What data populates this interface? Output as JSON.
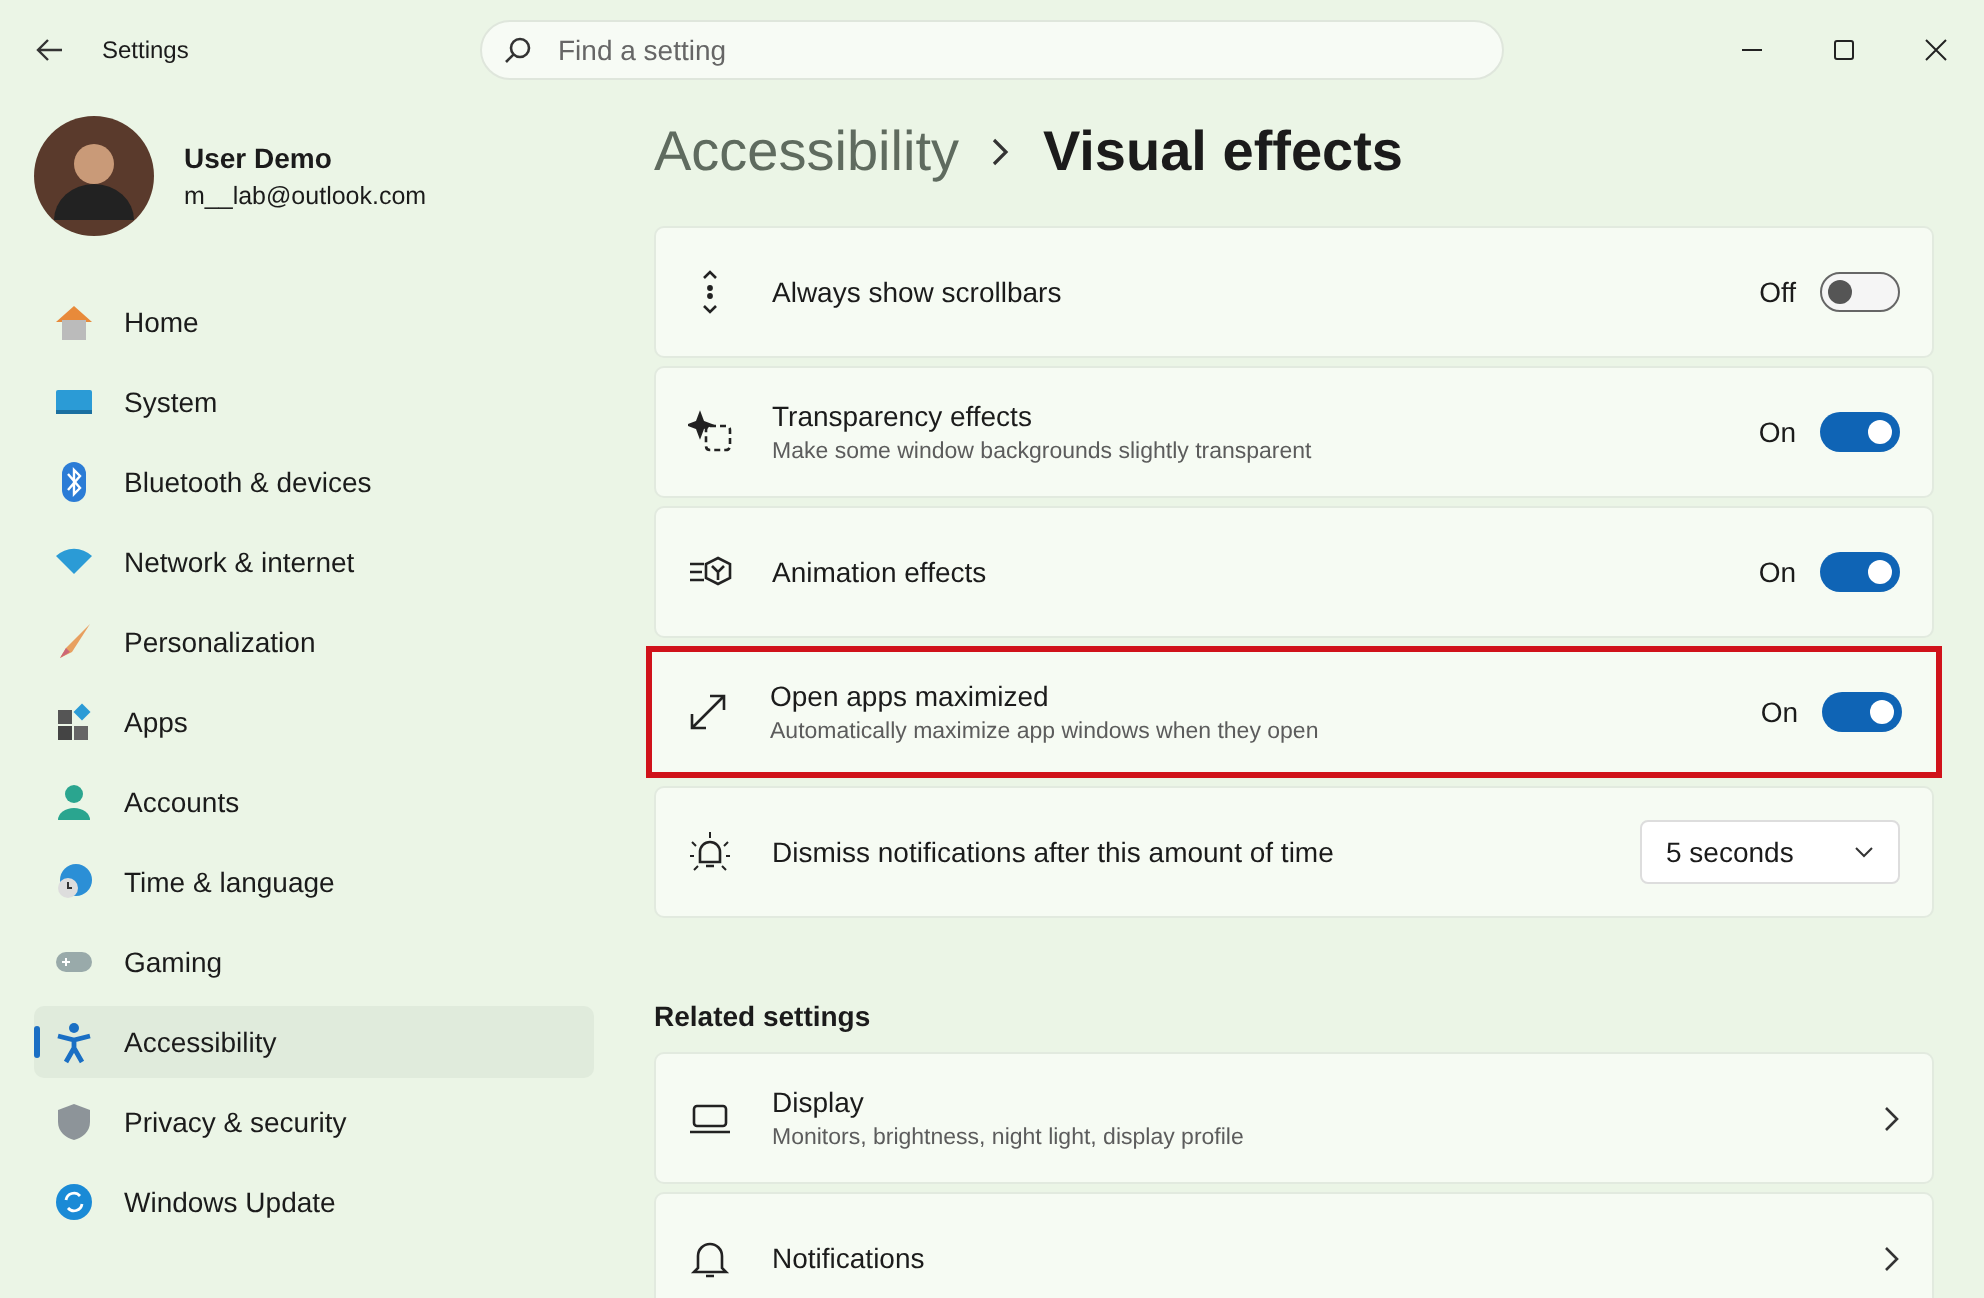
{
  "window": {
    "title": "Settings"
  },
  "search": {
    "placeholder": "Find a setting"
  },
  "profile": {
    "name": "User Demo",
    "email": "m__lab@outlook.com"
  },
  "sidebar": {
    "items": [
      {
        "label": "Home",
        "selected": false
      },
      {
        "label": "System",
        "selected": false
      },
      {
        "label": "Bluetooth & devices",
        "selected": false
      },
      {
        "label": "Network & internet",
        "selected": false
      },
      {
        "label": "Personalization",
        "selected": false
      },
      {
        "label": "Apps",
        "selected": false
      },
      {
        "label": "Accounts",
        "selected": false
      },
      {
        "label": "Time & language",
        "selected": false
      },
      {
        "label": "Gaming",
        "selected": false
      },
      {
        "label": "Accessibility",
        "selected": true
      },
      {
        "label": "Privacy & security",
        "selected": false
      },
      {
        "label": "Windows Update",
        "selected": false
      }
    ]
  },
  "breadcrumb": [
    "Accessibility",
    "Visual effects"
  ],
  "settings": [
    {
      "kind": "toggle",
      "title": "Always show scrollbars",
      "on": false,
      "state": "Off",
      "highlighted": false
    },
    {
      "kind": "toggle",
      "title": "Transparency effects",
      "description": "Make some window backgrounds slightly transparent",
      "on": true,
      "state": "On",
      "highlighted": false
    },
    {
      "kind": "toggle",
      "title": "Animation effects",
      "on": true,
      "state": "On",
      "highlighted": false
    },
    {
      "kind": "toggle",
      "title": "Open apps maximized",
      "description": "Automatically maximize app windows when they open",
      "on": true,
      "state": "On",
      "highlighted": true
    },
    {
      "kind": "dropdown",
      "title": "Dismiss notifications after this amount of time",
      "value": "5 seconds",
      "highlighted": false
    }
  ],
  "related": {
    "heading": "Related settings",
    "items": [
      {
        "title": "Display",
        "description": "Monitors, brightness, night light, display profile"
      },
      {
        "title": "Notifications"
      }
    ]
  }
}
